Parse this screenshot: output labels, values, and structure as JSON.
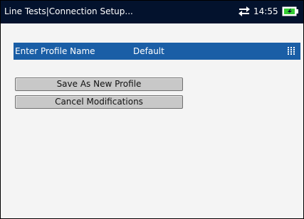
{
  "titlebar": {
    "title": "Line Tests|Connection Setup...",
    "time": "14:55",
    "background_color": "#03122d",
    "battery_color": "#33cc33",
    "icons": [
      "sync-arrows-icon",
      "battery-icon"
    ]
  },
  "profile": {
    "label": "Enter Profile Name",
    "value": "Default",
    "highlight_color": "#1a5ea6",
    "icon": "keypad-icon"
  },
  "actions": {
    "save_label": "Save As New Profile",
    "cancel_label": "Cancel Modifications"
  }
}
